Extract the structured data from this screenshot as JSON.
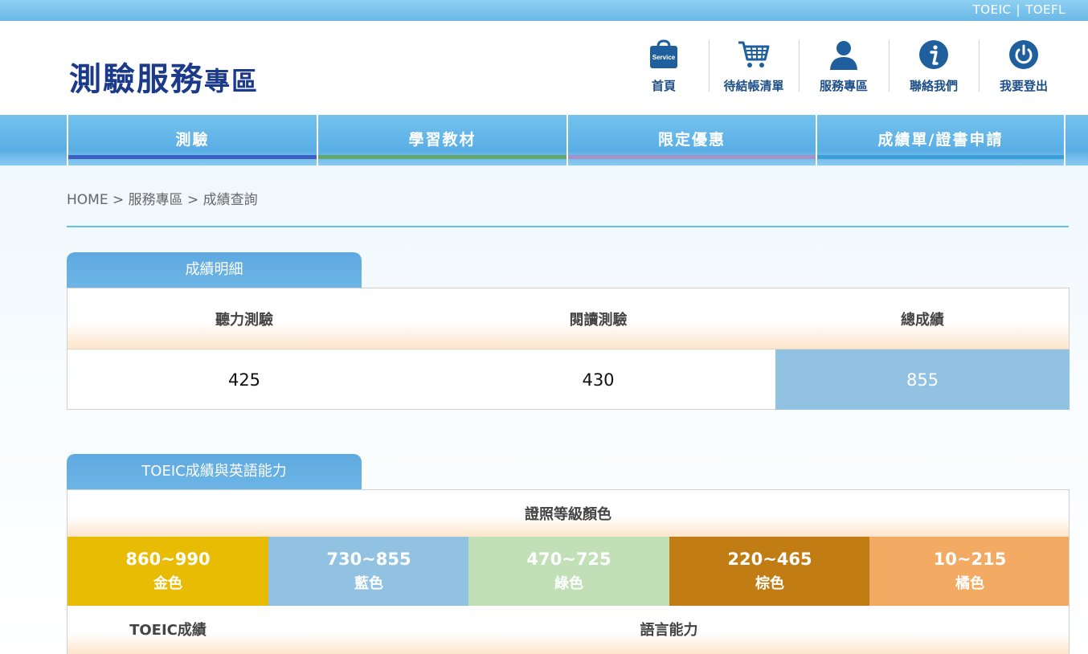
{
  "topbar": {
    "link_toeic": "TOEIC",
    "separator": "|",
    "link_toefl": "TOEFL"
  },
  "logo": {
    "main": "測驗服務",
    "sub": "專區"
  },
  "header_nav": [
    {
      "label": "首頁",
      "icon": "service-bag-icon",
      "badge": "Service"
    },
    {
      "label": "待結帳清單",
      "icon": "cart-icon"
    },
    {
      "label": "服務專區",
      "icon": "user-icon"
    },
    {
      "label": "聯絡我們",
      "icon": "info-icon"
    },
    {
      "label": "我要登出",
      "icon": "power-icon"
    }
  ],
  "menu": [
    {
      "label": "測驗",
      "color": "#3d5fc4"
    },
    {
      "label": "學習教材",
      "color": "#63a86a"
    },
    {
      "label": "限定優惠",
      "color": "#a592c8"
    },
    {
      "label": "成績單/證書申請",
      "color": "#3c9ed6"
    }
  ],
  "breadcrumb": "HOME > 服務專區 > 成績查詢",
  "score_section": {
    "tab": "成績明細",
    "headers": [
      "聽力測驗",
      "閱讀測驗",
      "總成績"
    ],
    "values": [
      "425",
      "430",
      "855"
    ]
  },
  "ability_section": {
    "tab": "TOEIC成績與英語能力",
    "cert_header": "證照等級顏色",
    "levels": [
      {
        "range": "860~990",
        "name": "金色",
        "color": "#e8bc05"
      },
      {
        "range": "730~855",
        "name": "藍色",
        "color": "#91c2e1"
      },
      {
        "range": "470~725",
        "name": "綠色",
        "color": "#c1e0b8"
      },
      {
        "range": "220~465",
        "name": "棕色",
        "color": "#c17d14"
      },
      {
        "range": "10~215",
        "name": "橘色",
        "color": "#f3aa62"
      }
    ],
    "col_score": "TOEIC成績",
    "col_ability": "語言能力"
  },
  "colors": {
    "brand_blue": "#1c3a8a",
    "accent": "#5ea9e0"
  }
}
